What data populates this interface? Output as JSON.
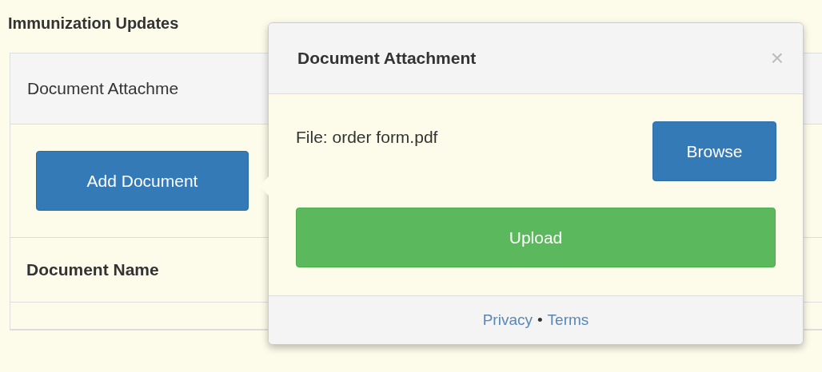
{
  "page_heading": "Immunization Updates",
  "panel": {
    "heading": "Document Attachme",
    "add_button": "Add Document",
    "columns": [
      "Document Name"
    ]
  },
  "popover": {
    "title": "Document Attachment",
    "close": "×",
    "file_label": "File: order form.pdf",
    "browse_button": "Browse",
    "upload_button": "Upload",
    "footer_links": [
      {
        "label": "Privacy"
      },
      {
        "label": "Terms"
      }
    ],
    "separator": "•"
  }
}
